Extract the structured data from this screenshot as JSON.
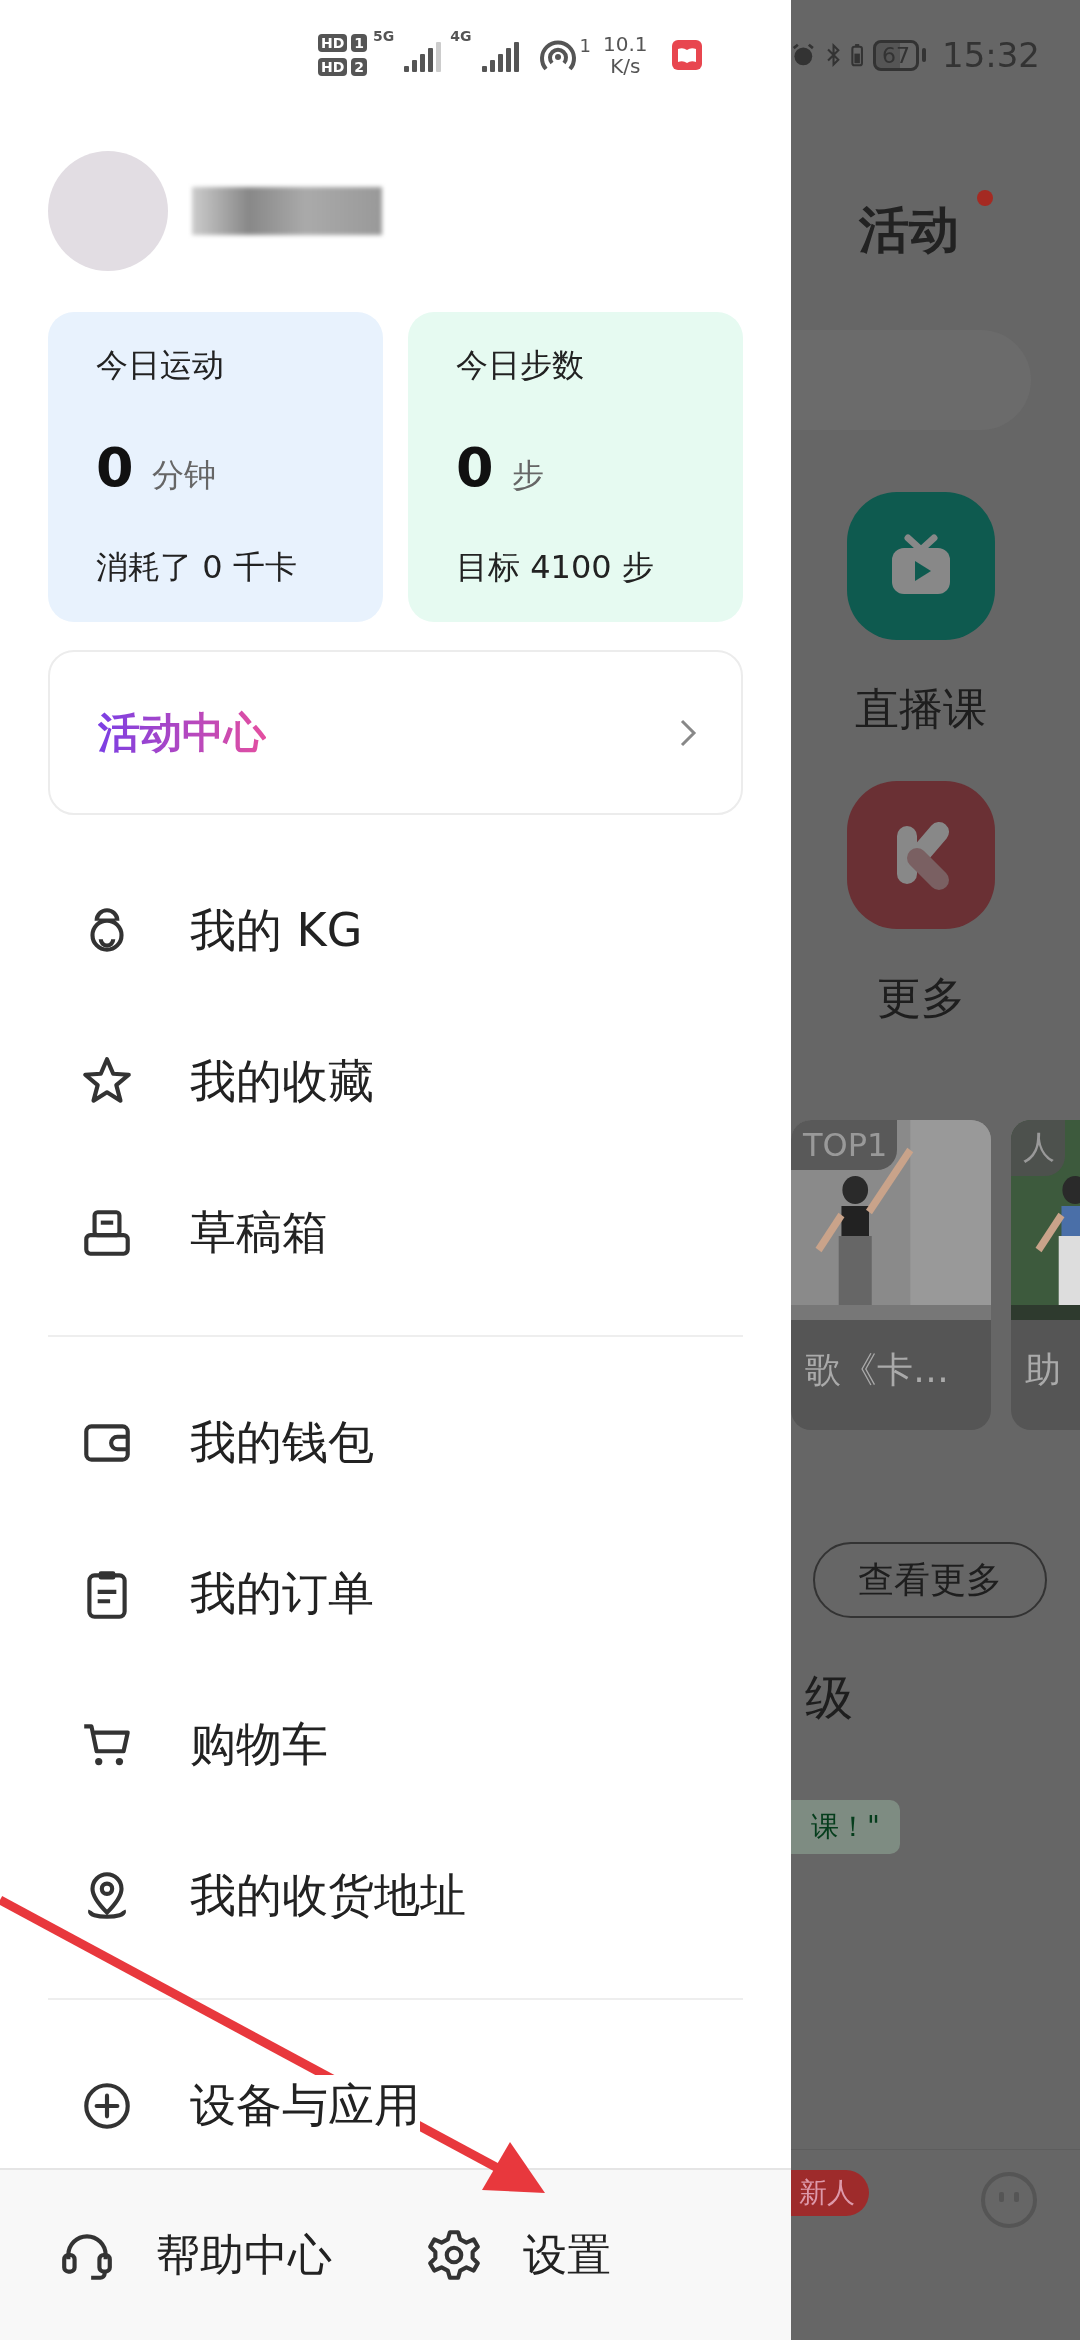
{
  "status_bar": {
    "sims": [
      {
        "hd": "HD",
        "slot": "1",
        "network": "5G"
      },
      {
        "hd": "HD",
        "slot": "2",
        "network": "4G"
      }
    ],
    "hotspot_count": "1",
    "speed": "10.1",
    "speed_unit": "K/s",
    "battery": "67",
    "time": "15:32"
  },
  "drawer": {
    "stats": [
      {
        "title": "今日运动",
        "value": "0",
        "unit": "分钟",
        "footer": "消耗了 0 千卡",
        "color": "#e8f2fd"
      },
      {
        "title": "今日步数",
        "value": "0",
        "unit": "步",
        "footer": "目标 4100 步",
        "color": "#e6faf1"
      }
    ],
    "activity_center": {
      "label": "活动中心"
    },
    "menu_groups": [
      [
        {
          "kind": "kettlebell",
          "label": "我的 KG"
        },
        {
          "kind": "star",
          "label": "我的收藏"
        },
        {
          "kind": "drafts",
          "label": "草稿箱"
        }
      ],
      [
        {
          "kind": "wallet",
          "label": "我的钱包"
        },
        {
          "kind": "clipboard",
          "label": "我的订单"
        },
        {
          "kind": "cart",
          "label": "购物车"
        },
        {
          "kind": "pin",
          "label": "我的收货地址"
        }
      ],
      [
        {
          "kind": "plus",
          "label": "设备与应用"
        }
      ]
    ],
    "bottom": [
      {
        "kind": "headset",
        "label": "帮助中心"
      },
      {
        "kind": "gear",
        "label": "设置"
      }
    ]
  },
  "background": {
    "title": "活动",
    "notification_dot": true,
    "shortcuts": [
      {
        "kind": "tv",
        "label": "直播课",
        "color": "#0e5a4f"
      },
      {
        "kind": "k",
        "label": "更多",
        "color": "#6a3034"
      }
    ],
    "cards": [
      {
        "tag": "TOP1",
        "caption": "歌《卡…"
      },
      {
        "tag": "人",
        "caption": "助"
      }
    ],
    "more_button": "查看更多",
    "section_title": "级",
    "tag": "课！\"",
    "badge": "新人"
  },
  "annotation_arrow": {
    "color": "#e8383d"
  }
}
